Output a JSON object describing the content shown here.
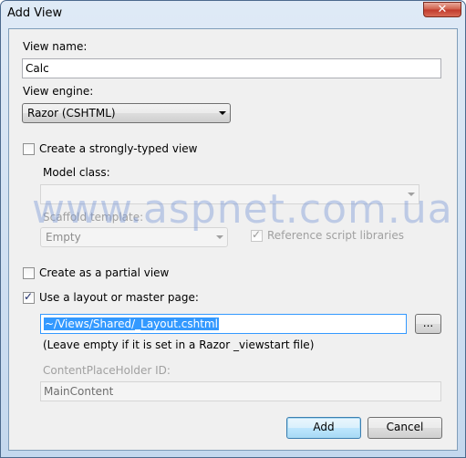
{
  "window": {
    "title": "Add View",
    "close_glyph": "✕"
  },
  "view_name": {
    "label": "View name:",
    "value": "Calc"
  },
  "view_engine": {
    "label": "View engine:",
    "selected": "Razor (CSHTML)"
  },
  "strongly_typed": {
    "label": "Create a strongly-typed view",
    "checked": false
  },
  "model_class": {
    "label": "Model class:",
    "value": ""
  },
  "scaffold": {
    "label": "Scaffold template:",
    "selected": "Empty"
  },
  "reference_scripts": {
    "label": "Reference script libraries",
    "checked": true
  },
  "partial_view": {
    "label": "Create as a partial view",
    "checked": false
  },
  "use_layout": {
    "label": "Use a layout or master page:",
    "checked": true
  },
  "layout_path": {
    "value": "~/Views/Shared/_Layout.cshtml",
    "browse_label": "..."
  },
  "layout_hint": "(Leave empty if it is set in a Razor _viewstart file)",
  "placeholder": {
    "label": "ContentPlaceHolder ID:",
    "value": "MainContent"
  },
  "buttons": {
    "add": "Add",
    "cancel": "Cancel"
  },
  "watermark": "www.aspnet.com.ua"
}
